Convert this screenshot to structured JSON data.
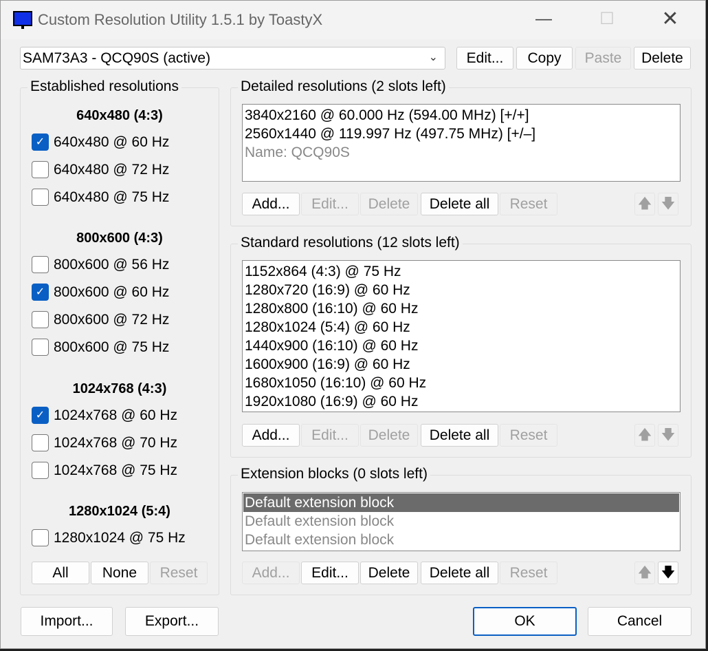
{
  "window": {
    "title": "Custom Resolution Utility 1.5.1 by ToastyX",
    "minimize": "—",
    "maximize": "☐",
    "close": "✕"
  },
  "top": {
    "monitor_select": "SAM73A3 - QCQ90S (active)",
    "chevron": "⌄",
    "edit_label": "Edit...",
    "copy_label": "Copy",
    "paste_label": "Paste",
    "delete_label": "Delete"
  },
  "established": {
    "title": "Established resolutions",
    "groups": [
      {
        "heading": "640x480 (4:3)",
        "items": [
          {
            "label": "640x480 @ 60 Hz",
            "checked": true
          },
          {
            "label": "640x480 @ 72 Hz",
            "checked": false
          },
          {
            "label": "640x480 @ 75 Hz",
            "checked": false
          }
        ]
      },
      {
        "heading": "800x600 (4:3)",
        "items": [
          {
            "label": "800x600 @ 56 Hz",
            "checked": false
          },
          {
            "label": "800x600 @ 60 Hz",
            "checked": true
          },
          {
            "label": "800x600 @ 72 Hz",
            "checked": false
          },
          {
            "label": "800x600 @ 75 Hz",
            "checked": false
          }
        ]
      },
      {
        "heading": "1024x768 (4:3)",
        "items": [
          {
            "label": "1024x768 @ 60 Hz",
            "checked": true
          },
          {
            "label": "1024x768 @ 70 Hz",
            "checked": false
          },
          {
            "label": "1024x768 @ 75 Hz",
            "checked": false
          }
        ]
      },
      {
        "heading": "1280x1024 (5:4)",
        "items": [
          {
            "label": "1280x1024 @ 75 Hz",
            "checked": false
          }
        ]
      }
    ],
    "all_label": "All",
    "none_label": "None",
    "reset_label": "Reset"
  },
  "detailed": {
    "title": "Detailed resolutions (2 slots left)",
    "items": [
      "3840x2160 @ 60.000 Hz (594.00 MHz) [+/+]",
      "2560x1440 @ 119.997 Hz (497.75 MHz) [+/–]"
    ],
    "name_item": "Name: QCQ90S",
    "add_label": "Add...",
    "edit_label": "Edit...",
    "delete_label": "Delete",
    "delete_all_label": "Delete all",
    "reset_label": "Reset",
    "up_arrow": "🡅",
    "down_arrow": "🡇"
  },
  "standard": {
    "title": "Standard resolutions (12 slots left)",
    "items": [
      "1152x864 (4:3) @ 75 Hz",
      "1280x720 (16:9) @ 60 Hz",
      "1280x800 (16:10) @ 60 Hz",
      "1280x1024 (5:4) @ 60 Hz",
      "1440x900 (16:10) @ 60 Hz",
      "1600x900 (16:9) @ 60 Hz",
      "1680x1050 (16:10) @ 60 Hz",
      "1920x1080 (16:9) @ 60 Hz"
    ],
    "add_label": "Add...",
    "edit_label": "Edit...",
    "delete_label": "Delete",
    "delete_all_label": "Delete all",
    "reset_label": "Reset",
    "up_arrow": "🡅",
    "down_arrow": "🡇"
  },
  "extension": {
    "title": "Extension blocks (0 slots left)",
    "items": [
      "Default extension block",
      "Default extension block",
      "Default extension block"
    ],
    "add_label": "Add...",
    "edit_label": "Edit...",
    "delete_label": "Delete",
    "delete_all_label": "Delete all",
    "reset_label": "Reset",
    "up_arrow": "🡅",
    "down_arrow": "🡇"
  },
  "bottom": {
    "import_label": "Import...",
    "export_label": "Export...",
    "ok_label": "OK",
    "cancel_label": "Cancel"
  },
  "colors": {
    "checkbox_checked": "#0a5fc4",
    "selection": "#6b6b6b",
    "app_icon": "#1030e8"
  }
}
